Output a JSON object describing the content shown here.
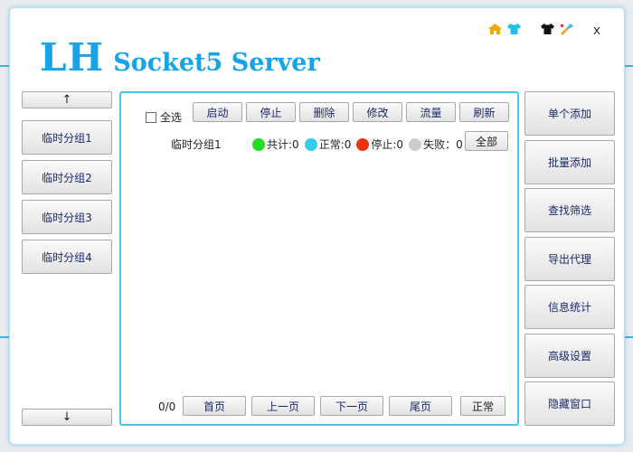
{
  "app": {
    "logo_main": "LH",
    "logo_sub": "Socket5 Server",
    "close_label": "x"
  },
  "colors": {
    "accent": "#18a3e8",
    "panel_border": "#45c6ef",
    "total": "#22dd22",
    "normal": "#33ccee",
    "stopped": "#ee3311",
    "failed": "#cccccc"
  },
  "title_icons": [
    "home-icon",
    "shirt-cyan-icon",
    "shirt-black-icon",
    "paint-brush-icon"
  ],
  "left_sidebar": {
    "up_label": "↑",
    "down_label": "↓",
    "groups": [
      "临时分组1",
      "临时分组2",
      "临时分组3",
      "临时分组4"
    ]
  },
  "toolbar": {
    "select_all_label": "全选",
    "start_label": "启动",
    "stop_label": "停止",
    "delete_label": "删除",
    "edit_label": "修改",
    "traffic_label": "流量",
    "refresh_label": "刷新"
  },
  "group_summary": {
    "name": "临时分组1",
    "total": "共计:0",
    "normal": "正常:0",
    "stopped": "停止:0",
    "failed": "失败：0",
    "all_label": "全部"
  },
  "pager": {
    "count": "0/0",
    "first": "首页",
    "prev": "上一页",
    "next": "下一页",
    "last": "尾页",
    "mode": "正常"
  },
  "right_sidebar": {
    "items": [
      "单个添加",
      "批量添加",
      "查找筛选",
      "导出代理",
      "信息统计",
      "高级设置",
      "隐藏窗口"
    ]
  }
}
